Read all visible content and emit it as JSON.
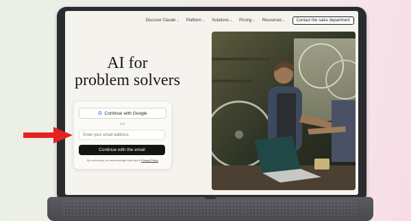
{
  "nav": {
    "items": [
      {
        "label": "Discover Claude",
        "chevron": "chevron-down-icon"
      },
      {
        "label": "Platform",
        "chevron": "chevron-down-icon"
      },
      {
        "label": "Solutions",
        "chevron": "chevron-down-icon"
      },
      {
        "label": "Pricing",
        "chevron": "chevron-down-icon"
      },
      {
        "label": "Resources",
        "chevron": "chevron-down-icon"
      }
    ],
    "contact_label": "Contact the sales department"
  },
  "hero": {
    "title_line1": "AI for",
    "title_line2": "problem solvers"
  },
  "signup": {
    "google_label": "Continue with Google",
    "or_label": "OR",
    "email_placeholder": "Enter your email address",
    "continue_label": "Continue with the email",
    "legal_prefix": "By continuing, you acknowledge Anthropic's",
    "legal_link": "Privacy Policy"
  },
  "photo": {
    "description_icon": "photo-workshop-icon"
  },
  "annotation": {
    "arrow_color": "#e52222"
  },
  "colors": {
    "accent_dark": "#141413",
    "page_bg": "#f5f3ee"
  }
}
